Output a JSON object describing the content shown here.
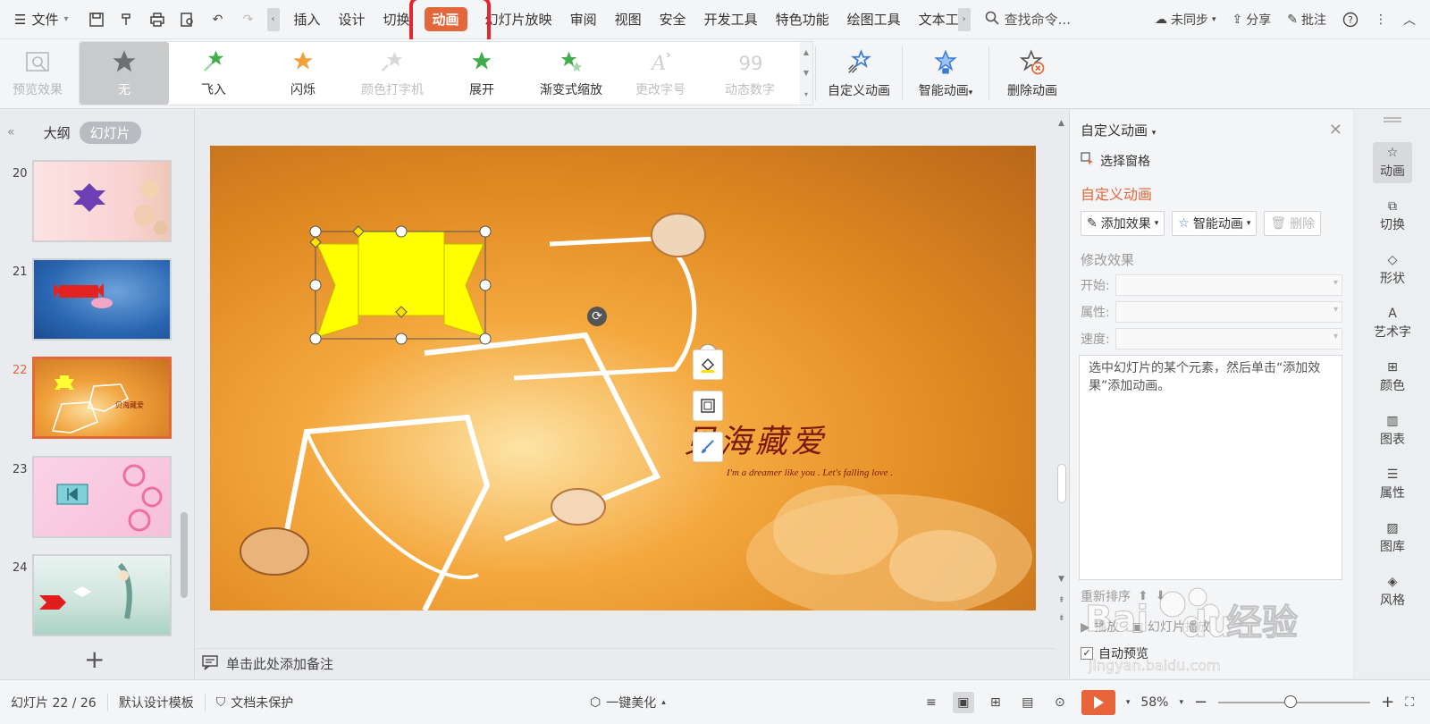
{
  "menubar": {
    "file_label": "文件",
    "tabs": [
      {
        "label": "插入"
      },
      {
        "label": "设计"
      },
      {
        "label": "切换"
      },
      {
        "label": "动画"
      },
      {
        "label": "幻灯片放映"
      },
      {
        "label": "审阅"
      },
      {
        "label": "视图"
      },
      {
        "label": "安全"
      },
      {
        "label": "开发工具"
      },
      {
        "label": "特色功能"
      },
      {
        "label": "绘图工具"
      },
      {
        "label": "文本工"
      }
    ],
    "active_tab": "动画",
    "search_label": "查找命令...",
    "sync_label": "未同步",
    "share_label": "分享",
    "comment_label": "批注"
  },
  "ribbon": {
    "preview_label": "预览效果",
    "gallery": [
      {
        "label": "无",
        "state": "selected"
      },
      {
        "label": "飞入",
        "state": "normal"
      },
      {
        "label": "闪烁",
        "state": "normal"
      },
      {
        "label": "颜色打字机",
        "state": "disabled"
      },
      {
        "label": "展开",
        "state": "normal"
      },
      {
        "label": "渐变式缩放",
        "state": "normal"
      },
      {
        "label": "更改字号",
        "state": "disabled"
      },
      {
        "label": "动态数字",
        "state": "disabled"
      }
    ],
    "custom_anim_label": "自定义动画",
    "smart_anim_label": "智能动画",
    "delete_anim_label": "删除动画"
  },
  "left_panel": {
    "tab_outline": "大纲",
    "tab_slides": "幻灯片",
    "slides": [
      {
        "num": "20"
      },
      {
        "num": "21"
      },
      {
        "num": "22"
      },
      {
        "num": "23"
      },
      {
        "num": "24"
      }
    ],
    "current": "22"
  },
  "slide": {
    "title": "贝海藏爱",
    "subtitle": "I'm a dreamer like you . Let's falling love ."
  },
  "notes_placeholder": "单击此处添加备注",
  "task_pane": {
    "title": "自定义动画",
    "select_pane": "选择窗格",
    "section": "自定义动画",
    "add_effect": "添加效果",
    "smart_anim": "智能动画",
    "delete": "删除",
    "modify_effect": "修改效果",
    "start_label": "开始:",
    "property_label": "属性:",
    "speed_label": "速度:",
    "hint": "选中幻灯片的某个元素，然后单击“添加效果”添加动画。",
    "reorder_label": "重新排序",
    "play_label": "播放",
    "slideshow_label": "幻灯片播放",
    "auto_preview": "自动预览"
  },
  "sidebar": {
    "items": [
      {
        "label": "动画"
      },
      {
        "label": "切换"
      },
      {
        "label": "形状"
      },
      {
        "label": "艺术字"
      },
      {
        "label": "颜色"
      },
      {
        "label": "图表"
      },
      {
        "label": "属性"
      },
      {
        "label": "图库"
      },
      {
        "label": "风格"
      }
    ]
  },
  "statusbar": {
    "slide_info": "幻灯片 22 / 26",
    "template": "默认设计模板",
    "protect": "文档未保护",
    "beautify": "一键美化",
    "zoom": "58%",
    "zoom_fraction": 0.58
  },
  "watermark": {
    "text": "Baidu经验",
    "url": "jingyan.baidu.com"
  },
  "colors": {
    "accent": "#e2673a",
    "highlight_box": "#e8262a",
    "shape_fill": "#ffff00"
  }
}
